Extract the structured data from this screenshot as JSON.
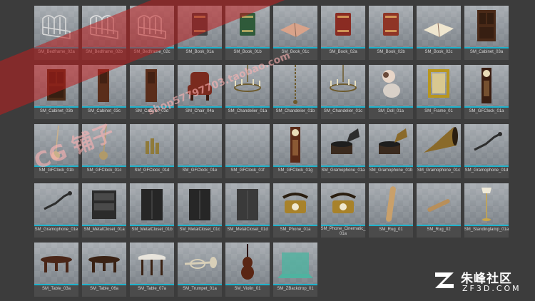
{
  "assets": [
    {
      "label": "SM_Bedframe_02a",
      "icon": "bedframe-icon",
      "color": "#d9d9d9"
    },
    {
      "label": "SM_Bedframe_02b",
      "icon": "bedframe-icon",
      "color": "#e0e0e0"
    },
    {
      "label": "SM_Bedframe_02c",
      "icon": "bedframe-icon",
      "color": "#e6e6e6"
    },
    {
      "label": "SM_Book_01a",
      "icon": "book-icon",
      "color": "#3f3f3f"
    },
    {
      "label": "SM_Book_01b",
      "icon": "book-icon",
      "color": "#2f5a3a"
    },
    {
      "label": "SM_Book_01c",
      "icon": "open-book-icon",
      "color": "#d9a38a"
    },
    {
      "label": "SM_Book_02a",
      "icon": "book-icon",
      "color": "#8a2b22"
    },
    {
      "label": "SM_Book_02b",
      "icon": "book-icon",
      "color": "#8f3526"
    },
    {
      "label": "SM_Book_02c",
      "icon": "open-book-icon",
      "color": "#efe6cf"
    },
    {
      "label": "SM_Cabinet_03a",
      "icon": "cabinet-icon",
      "color": "#4a2a18"
    },
    {
      "label": "SM_Cabinet_03b",
      "icon": "cabinet-icon",
      "color": "#4a2a18"
    },
    {
      "label": "SM_Cabinet_03c",
      "icon": "door-icon",
      "color": "#5a2d1a"
    },
    {
      "label": "SM_Cabinet_03d",
      "icon": "door-icon",
      "color": "#5a2d1a"
    },
    {
      "label": "SM_Chair_04a",
      "icon": "chair-icon",
      "color": "#7a2a1e"
    },
    {
      "label": "SM_Chandelier_01a",
      "icon": "chandelier-icon",
      "color": "#6d5a2c"
    },
    {
      "label": "SM_Chandelier_01b",
      "icon": "chain-icon",
      "color": "#6d5a2c"
    },
    {
      "label": "SM_Chandelier_01c",
      "icon": "chandelier-icon",
      "color": "#6d5a2c"
    },
    {
      "label": "SM_Doll_01a",
      "icon": "doll-icon",
      "color": "#e8d6c8"
    },
    {
      "label": "SM_Frame_01",
      "icon": "frame-icon",
      "color": "#b8961e"
    },
    {
      "label": "SM_GFClock_01a",
      "icon": "clock-icon",
      "color": "#3a1e12"
    },
    {
      "label": "SM_GFClock_01b",
      "icon": "pendulum-icon",
      "color": "#c9b08a"
    },
    {
      "label": "SM_GFClock_01c",
      "icon": "pendulum-icon",
      "color": "#b09a6a"
    },
    {
      "label": "SM_GFClock_01d",
      "icon": "weights-icon",
      "color": "#8f7a3a"
    },
    {
      "label": "SM_GFClock_01e",
      "icon": "blank-icon",
      "color": "#9aa0a6"
    },
    {
      "label": "SM_GFClock_01f",
      "icon": "blank-icon",
      "color": "#9aa0a6"
    },
    {
      "label": "SM_GFClock_01g",
      "icon": "clock-icon",
      "color": "#5a2a18"
    },
    {
      "label": "SM_Gramophone_01a",
      "icon": "gramophone-icon",
      "color": "#2d2d2d"
    },
    {
      "label": "SM_Gramophone_01b",
      "icon": "gramophone-icon",
      "color": "#8a6a2a"
    },
    {
      "label": "SM_Gramophone_01c",
      "icon": "horn-icon",
      "color": "#8a6a2a"
    },
    {
      "label": "SM_Gramophone_01d",
      "icon": "crank-icon",
      "color": "#2d2d2d"
    },
    {
      "label": "SM_Gramophone_01e",
      "icon": "crank-icon",
      "color": "#2d2d2d"
    },
    {
      "label": "SM_MetalCloset_01a",
      "icon": "shelf-icon",
      "color": "#2b2b2b"
    },
    {
      "label": "SM_MetalCloset_01b",
      "icon": "closet-icon",
      "color": "#262626"
    },
    {
      "label": "SM_MetalCloset_01c",
      "icon": "closet-icon",
      "color": "#262626"
    },
    {
      "label": "SM_MetalCloset_01d",
      "icon": "closet-icon",
      "color": "#3a3a3a"
    },
    {
      "label": "SM_Phone_01a",
      "icon": "phone-icon",
      "color": "#a8822a"
    },
    {
      "label": "SM_Phone_Cinematic_ 01a",
      "icon": "phone-icon",
      "color": "#a8822a"
    },
    {
      "label": "SM_Rug_01",
      "icon": "rug-icon",
      "color": "#c9a06a"
    },
    {
      "label": "SM_Rug_02",
      "icon": "rug-roll-icon",
      "color": "#b88f5a"
    },
    {
      "label": "SM_Standinglamp_01a",
      "icon": "lamp-icon",
      "color": "#c9a64a"
    },
    {
      "label": "SM_Table_03a",
      "icon": "table-icon",
      "color": "#4a2618"
    },
    {
      "label": "SM_Table_06a",
      "icon": "table-icon",
      "color": "#3a2214"
    },
    {
      "label": "SM_Table_07a",
      "icon": "demilune-table-icon",
      "color": "#e8e4dc"
    },
    {
      "label": "SM_Trumpet_01a",
      "icon": "trumpet-icon",
      "color": "#d8cfb8"
    },
    {
      "label": "SM_Violin_01",
      "icon": "violin-icon",
      "color": "#5a2614"
    },
    {
      "label": "SM_ZBackdrop_01",
      "icon": "backdrop-icon",
      "color": "#4fb3a0"
    }
  ],
  "watermark": {
    "line1": "CG 铺子",
    "line2": "shop57797703.taobao.com"
  },
  "brand": {
    "name_cn": "朱峰社区",
    "name_en": "ZF3D.COM",
    "logo_icon": "zf-logo-icon"
  },
  "accent": "#1fb3cc"
}
